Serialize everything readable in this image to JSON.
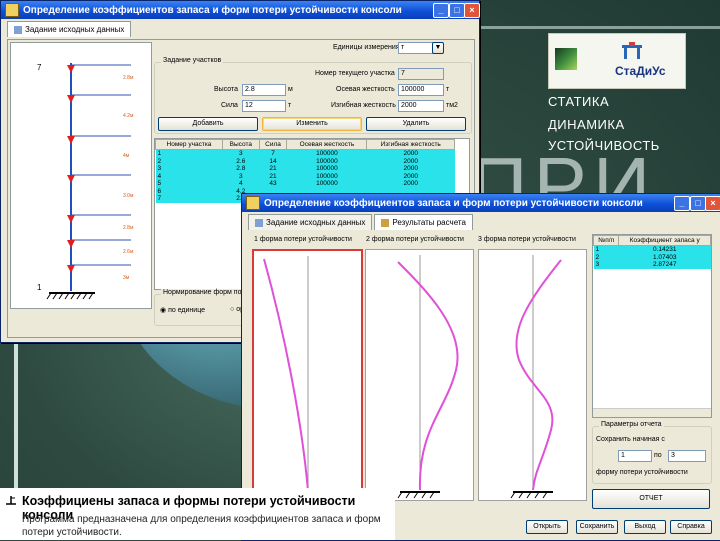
{
  "background": {
    "text": "ПРИ"
  },
  "logo": {
    "name": "СтаДиУс"
  },
  "side_menu": [
    "СТАТИКА",
    "ДИНАМИКА",
    "УСТОЙЧИВОСТЬ"
  ],
  "win1": {
    "title": "Определение коэффициентов запаса и форм потери устойчивости консоли",
    "tab": "Задание исходных данных",
    "units_label": "Единицы измерения",
    "units_value": "т",
    "group_title": "Задание участков",
    "current_label": "Номер текущего участка",
    "current_value": "7",
    "height_label": "Высота",
    "height_value": "2.8",
    "height_unit": "м",
    "axial_label": "Осевая жесткость",
    "axial_value": "100000",
    "axial_unit": "т",
    "force_label": "Сила",
    "force_value": "12",
    "force_unit": "т",
    "bending_label": "Изгибная жесткость",
    "bending_value": "2000",
    "bending_unit": "тм2",
    "btn_add": "Добавить",
    "btn_edit": "Изменить",
    "btn_delete": "Удалить",
    "table_headers": [
      "Номер участка",
      "Высота",
      "Сила",
      "Осевая жесткость",
      "Изгибная жесткость"
    ],
    "table_rows": [
      [
        "1",
        "3",
        "7",
        "100000",
        "2000"
      ],
      [
        "2",
        "2.6",
        "14",
        "100000",
        "2000"
      ],
      [
        "3",
        "2.8",
        "21",
        "100000",
        "2000"
      ],
      [
        "4",
        "3",
        "21",
        "100000",
        "2000"
      ],
      [
        "5",
        "4",
        "43",
        "100000",
        "2000"
      ],
      [
        "6",
        "4.2",
        "",
        "",
        ""
      ],
      [
        "7",
        "2.8",
        "",
        "",
        ""
      ]
    ],
    "norm_title": "Нормирование форм потери",
    "norm_opt1": "по единице",
    "norm_opt2": "орто",
    "scheme_top": "7",
    "scheme_bottom": "1",
    "scheme_labels": [
      "2.8м",
      "4.2м",
      "4м",
      "3.0м",
      "2.8м",
      "2.6м",
      "3м"
    ]
  },
  "win2": {
    "title": "Определение коэффициентов запаса и форм потери устойчивости консоли",
    "tab1": "Задание исходных данных",
    "tab2": "Результаты расчета",
    "plot1": "1 форма потери устойчивости",
    "plot2": "2 форма потери устойчивости",
    "plot3": "3 форма потери устойчивости",
    "res_headers": [
      "№п/п",
      "Коэффициент запаса у"
    ],
    "res_rows": [
      [
        "1",
        "0.14231"
      ],
      [
        "2",
        "1.07403"
      ],
      [
        "3",
        "2.87247"
      ]
    ],
    "report_group": "Параметры отчета",
    "save_from": "Сохранить начиная с",
    "from_value": "1",
    "to_label": "по",
    "to_value": "3",
    "forms_label": "форму потери устойчивости",
    "btn_report": "ОТЧЕТ",
    "btn_open": "Открыть",
    "btn_save": "Сохранить",
    "btn_exit": "Выход",
    "btn_help": "Справка"
  },
  "caption": {
    "title": "Коэффициены запаса и формы потери устойчивости консоли",
    "body": "Программа предназначена для определения коэффициентов запаса и форм потери устойчивости."
  }
}
